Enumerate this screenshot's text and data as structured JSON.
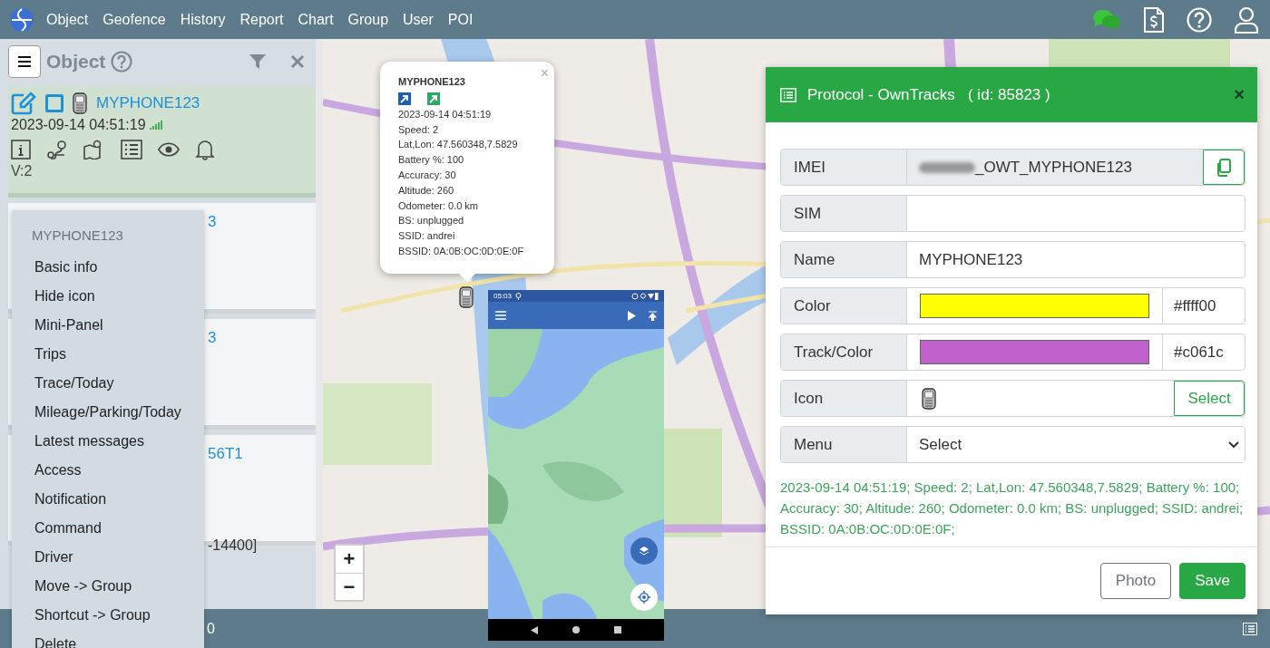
{
  "nav": {
    "menu": [
      "Object",
      "Geofence",
      "History",
      "Report",
      "Chart",
      "Group",
      "User",
      "POI"
    ]
  },
  "sidebar": {
    "title": "Object",
    "objects": [
      {
        "name": "MYPHONE123",
        "time": "2023-09-14 04:51:19",
        "version": "V:2",
        "checked": false,
        "selected": true
      },
      {
        "name": "3",
        "selected": false
      },
      {
        "name": "3",
        "selected": false
      },
      {
        "name": "56T1",
        "detail": "-14400]",
        "selected": false
      }
    ]
  },
  "context_menu": {
    "title": "MYPHONE123",
    "items": [
      "Basic info",
      "Hide icon",
      "Mini-Panel",
      "Trips",
      "Trace/Today",
      "Mileage/Parking/Today",
      "Latest messages",
      "Access",
      "Notification",
      "Command",
      "Driver",
      "Move -> Group",
      "Shortcut -> Group",
      "Delete"
    ]
  },
  "map_popup": {
    "title": "MYPHONE123",
    "close": "×",
    "lines": [
      "2023-09-14 04:51:19",
      "Speed: 2",
      "Lat,Lon: 47.560348,7.5829",
      "Battery %: 100",
      "Accuracy: 30",
      "Altitude: 260",
      "Odometer: 0.0 km",
      "BS: unplugged",
      "SSID: andrei",
      "BSSID: 0A:0B:OC:0D:0E:0F"
    ]
  },
  "map_controls": {
    "zoom_in": "+",
    "zoom_out": "−"
  },
  "phone": {
    "time": "05:03"
  },
  "dialog": {
    "title": "Protocol - OwnTracks",
    "id": "( id: 85823 )",
    "close": "×",
    "fields": [
      {
        "label": "IMEI",
        "kind": "readonly",
        "value": "_OWT_MYPHONE123"
      },
      {
        "label": "SIM",
        "kind": "text"
      },
      {
        "label": "Name",
        "kind": "text",
        "value": "MYPHONE123"
      },
      {
        "label": "Color",
        "kind": "color",
        "color": "#ffff00",
        "value": "#ffff00"
      },
      {
        "label": "Track/Color",
        "kind": "color",
        "color": "#c061cb",
        "value": "#c061c"
      },
      {
        "label": "Icon",
        "kind": "icon",
        "button": "Select"
      },
      {
        "label": "Menu",
        "kind": "select",
        "value": "Select"
      }
    ],
    "message": "2023-09-14 04:51:19; Speed: 2; Lat,Lon: 47.560348,7.5829; Battery %: 100; Accuracy: 30; Altitude: 260; Odometer: 0.0 km; BS: unplugged; SSID: andrei; BSSID: 0A:0B:OC:0D:0E:0F;",
    "buttons": [
      "Photo",
      "Save"
    ]
  },
  "status_bar": {
    "text": "0"
  }
}
